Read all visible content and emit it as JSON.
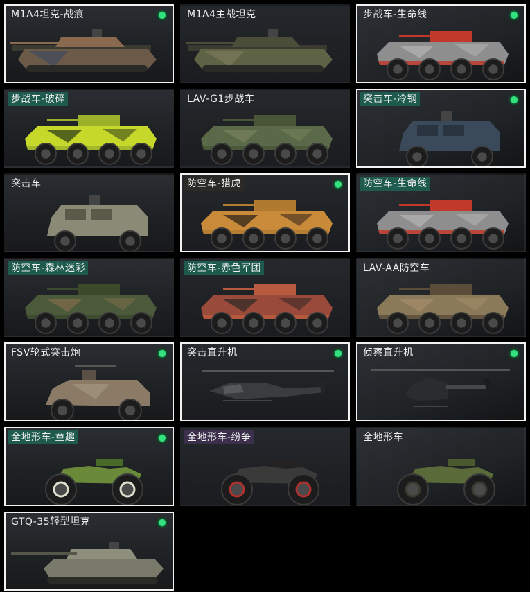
{
  "vehicles": [
    {
      "name": "M1A4坦克-战痕",
      "selected": true,
      "owned": true,
      "kind": "tank",
      "colors": [
        "#6b5a48",
        "#3e4a5c",
        "#8a6a4e"
      ]
    },
    {
      "name": "M1A4主战坦克",
      "selected": false,
      "owned": false,
      "kind": "tank",
      "colors": [
        "#5f6346",
        "#7a7a5a",
        "#4a4d38"
      ]
    },
    {
      "name": "步战车-生命线",
      "selected": true,
      "owned": true,
      "kind": "wheeled8",
      "colors": [
        "#8e8e8e",
        "#b0b0b0",
        "#c0392b"
      ]
    },
    {
      "name": "步战车-破碎",
      "selected": false,
      "owned": false,
      "kind": "wheeled8",
      "colors": [
        "#c6d82a",
        "#3a4a1a",
        "#9db02a"
      ],
      "label_style": "hl-green"
    },
    {
      "name": "LAV-G1步战车",
      "selected": false,
      "owned": false,
      "kind": "wheeled8",
      "colors": [
        "#5a6a48",
        "#73805a",
        "#4a5538"
      ]
    },
    {
      "name": "突击车-冷钢",
      "selected": true,
      "owned": true,
      "kind": "mrap",
      "colors": [
        "#3b4a5a",
        "#52606e",
        "#2a3440"
      ],
      "label_style": "hl-green"
    },
    {
      "name": "突击车",
      "selected": false,
      "owned": false,
      "kind": "mrap",
      "colors": [
        "#8a8a76",
        "#a0a08a",
        "#5a5a4a"
      ]
    },
    {
      "name": "防空车-猎虎",
      "selected": true,
      "owned": true,
      "kind": "wheeled8",
      "colors": [
        "#c98a3a",
        "#3a2a1a",
        "#b07a30"
      ],
      "label_style": "hl-orange"
    },
    {
      "name": "防空车-生命线",
      "selected": false,
      "owned": false,
      "kind": "wheeled8",
      "colors": [
        "#8e8e8e",
        "#b0b0b0",
        "#c0392b"
      ],
      "label_style": "hl-green"
    },
    {
      "name": "防空车-森林迷彩",
      "selected": false,
      "owned": false,
      "kind": "wheeled8",
      "colors": [
        "#4a5a3a",
        "#7a6a4a",
        "#3a4a2a"
      ],
      "label_style": "hl-green"
    },
    {
      "name": "防空车-赤色军团",
      "selected": false,
      "owned": false,
      "kind": "wheeled8",
      "colors": [
        "#9a4a3a",
        "#3a2a28",
        "#b85a40"
      ],
      "label_style": "hl-green"
    },
    {
      "name": "LAV-AA防空车",
      "selected": false,
      "owned": false,
      "kind": "wheeled8",
      "colors": [
        "#8a7a5a",
        "#a08a66",
        "#5a4e3a"
      ]
    },
    {
      "name": "FSV轮式突击炮",
      "selected": true,
      "owned": true,
      "kind": "armoredcar",
      "colors": [
        "#8a7a66",
        "#a89a86",
        "#5a5046"
      ]
    },
    {
      "name": "突击直升机",
      "selected": true,
      "owned": true,
      "kind": "helicopter",
      "colors": [
        "#3a3d40",
        "#55595c",
        "#222426"
      ]
    },
    {
      "name": "侦察直升机",
      "selected": true,
      "owned": true,
      "kind": "scouthelo",
      "colors": [
        "#2a2c2e",
        "#44484a",
        "#1a1c1d"
      ]
    },
    {
      "name": "全地形车-童趣",
      "selected": true,
      "owned": true,
      "kind": "atv",
      "colors": [
        "#6a8a3a",
        "#e0e0d0",
        "#4a6a2a"
      ],
      "label_style": "hl-green"
    },
    {
      "name": "全地形车-纷争",
      "selected": false,
      "owned": false,
      "kind": "atv",
      "colors": [
        "#3a3a3a",
        "#b03030",
        "#222222"
      ],
      "label_style": "hl-purple"
    },
    {
      "name": "全地形车",
      "selected": false,
      "owned": false,
      "kind": "atv",
      "colors": [
        "#5a6a38",
        "#3a3a30",
        "#4a5a2e"
      ]
    },
    {
      "name": "GTQ-35轻型坦克",
      "selected": true,
      "owned": true,
      "kind": "lighttank",
      "colors": [
        "#7a7a6a",
        "#8e8e7c",
        "#55564a"
      ]
    }
  ]
}
